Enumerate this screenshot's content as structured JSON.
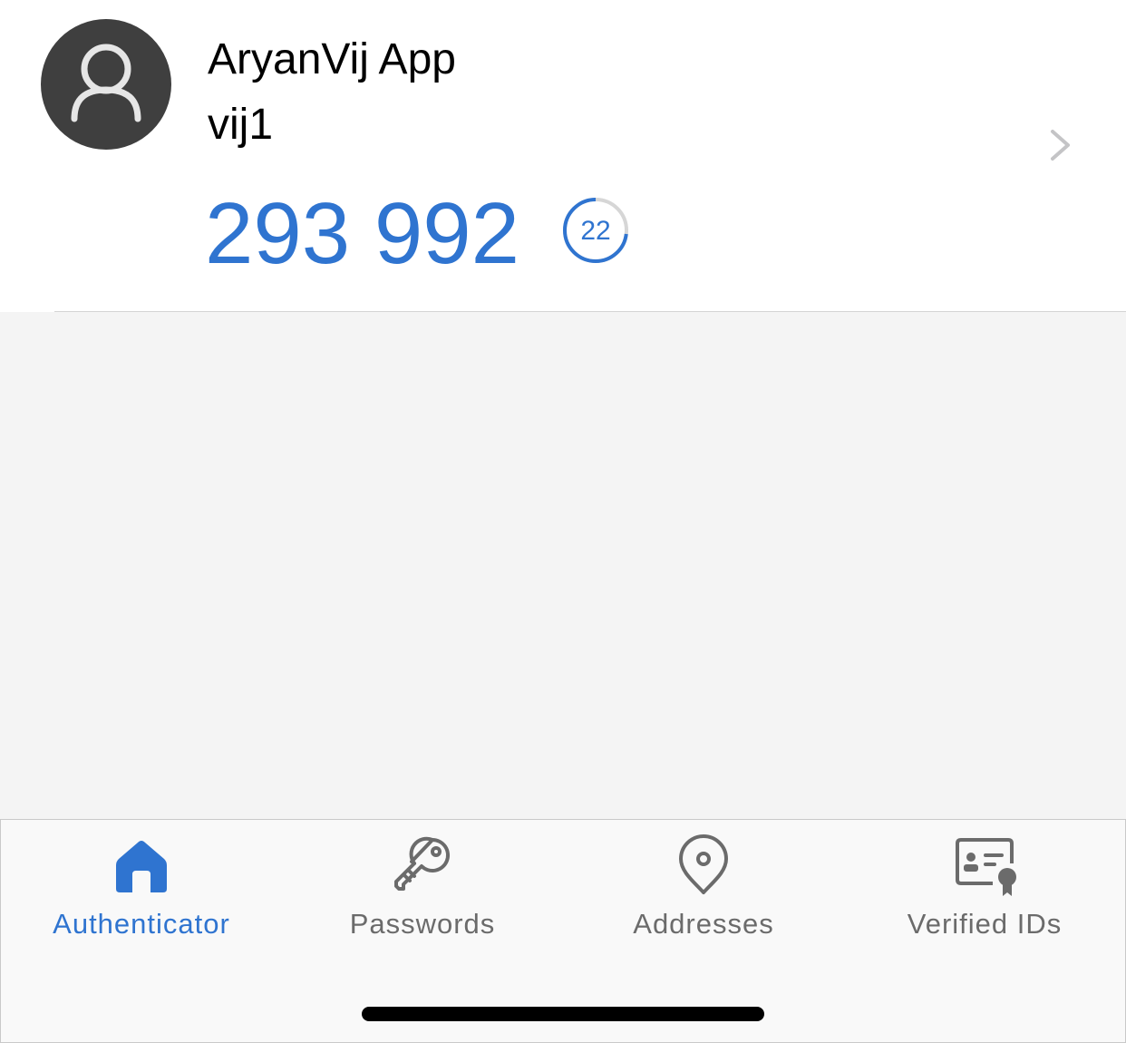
{
  "account": {
    "name": "AryanVij App",
    "username": "vij1",
    "code": "293 992",
    "seconds_remaining": "22",
    "timer_fraction": 0.73,
    "avatar_icon": "person-icon",
    "chevron_icon": "chevron-right-icon"
  },
  "tabs": [
    {
      "label": "Authenticator",
      "icon": "home-icon",
      "active": true
    },
    {
      "label": "Passwords",
      "icon": "key-icon",
      "active": false
    },
    {
      "label": "Addresses",
      "icon": "location-pin-icon",
      "active": false
    },
    {
      "label": "Verified IDs",
      "icon": "certificate-icon",
      "active": false
    }
  ],
  "colors": {
    "accent": "#2f74d0",
    "inactive": "#6b6b6b",
    "avatar_bg": "#3f3f3f",
    "content_bg": "#f4f4f4",
    "tabbar_bg": "#f9f9f9"
  }
}
